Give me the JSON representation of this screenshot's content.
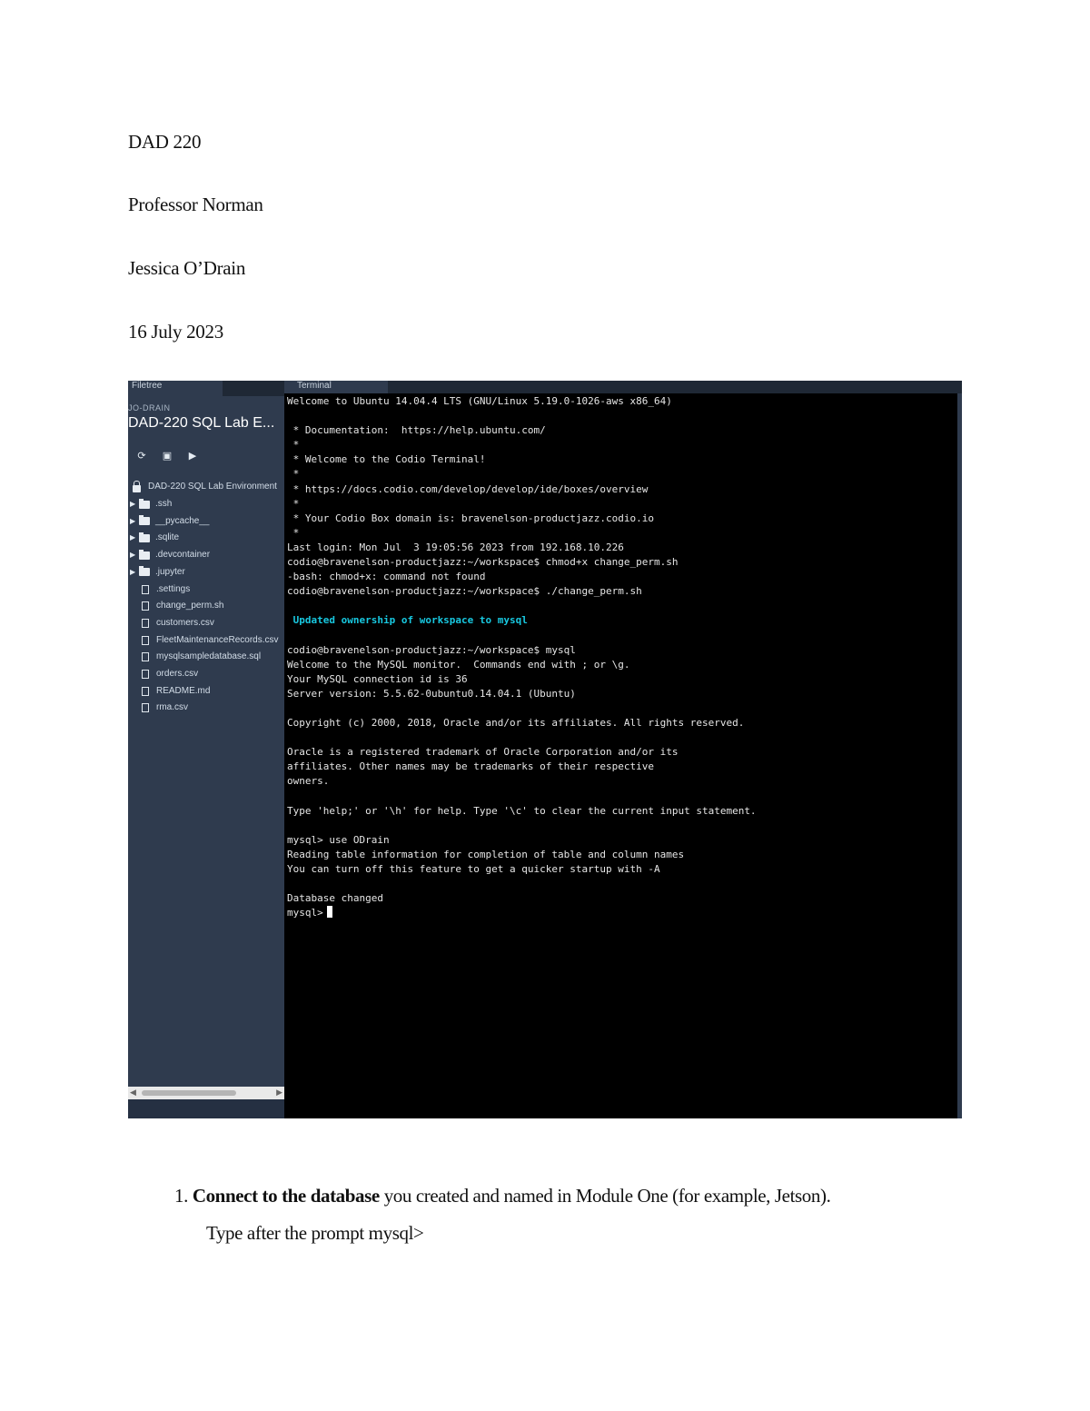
{
  "header": {
    "course": "DAD 220",
    "professor": "Professor Norman",
    "student": "Jessica O’Drain",
    "date": "16 July 2023"
  },
  "screenshot": {
    "filetree_tab": "Filetree",
    "project_small": "JO-DRAIN",
    "project_title": "DAD-220 SQL Lab E...",
    "root": "DAD-220 SQL Lab Environment",
    "folders": [
      ".ssh",
      "__pycache__",
      ".sqlite",
      ".devcontainer",
      ".jupyter"
    ],
    "files": [
      ".settings",
      "change_perm.sh",
      "customers.csv",
      "FleetMaintenanceRecords.csv",
      "mysqlsampledatabase.sql",
      "orders.csv",
      "README.md",
      "rma.csv"
    ],
    "terminal_tab": "Terminal",
    "terminal_lines": [
      "Welcome to Ubuntu 14.04.4 LTS (GNU/Linux 5.19.0-1026-aws x86_64)",
      "",
      " * Documentation:  https://help.ubuntu.com/",
      " *",
      " * Welcome to the Codio Terminal!",
      " *",
      " * https://docs.codio.com/develop/develop/ide/boxes/overview",
      " *",
      " * Your Codio Box domain is: bravenelson-productjazz.codio.io",
      " *",
      "Last login: Mon Jul  3 19:05:56 2023 from 192.168.10.226",
      "codio@bravenelson-productjazz:~/workspace$ chmod+x change_perm.sh",
      "-bash: chmod+x: command not found",
      "codio@bravenelson-productjazz:~/workspace$ ./change_perm.sh",
      "",
      " Updated ownership of workspace to mysql",
      "",
      "codio@bravenelson-productjazz:~/workspace$ mysql",
      "Welcome to the MySQL monitor.  Commands end with ; or \\g.",
      "Your MySQL connection id is 36",
      "Server version: 5.5.62-0ubuntu0.14.04.1 (Ubuntu)",
      "",
      "Copyright (c) 2000, 2018, Oracle and/or its affiliates. All rights reserved.",
      "",
      "Oracle is a registered trademark of Oracle Corporation and/or its",
      "affiliates. Other names may be trademarks of their respective",
      "owners.",
      "",
      "Type 'help;' or '\\h' for help. Type '\\c' to clear the current input statement.",
      "",
      "mysql> use ODrain",
      "Reading table information for completion of table and column names",
      "You can turn off this feature to get a quicker startup with -A",
      "",
      "Database changed"
    ],
    "prompt": "mysql>"
  },
  "question": {
    "number": "1.",
    "bold": "Connect to the database",
    "rest": " you created and named in Module One (for example, Jetson).",
    "instruction": "Type after the prompt mysql>"
  }
}
